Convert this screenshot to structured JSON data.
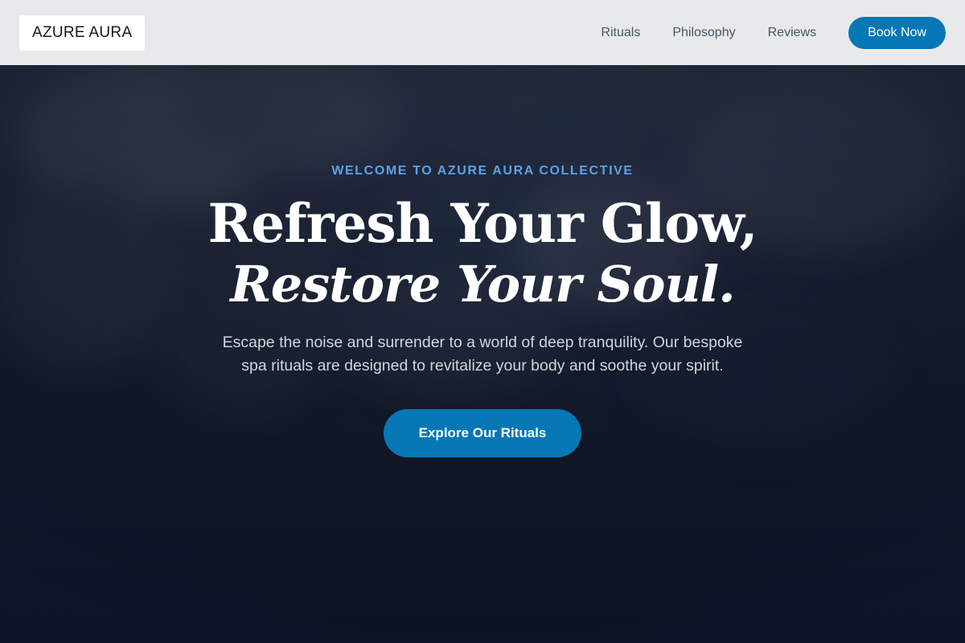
{
  "header": {
    "logo_text": "AZURE AURA",
    "nav": [
      {
        "label": "Rituals"
      },
      {
        "label": "Philosophy"
      },
      {
        "label": "Reviews"
      }
    ],
    "book_button": "Book Now"
  },
  "hero": {
    "eyebrow": "WELCOME TO AZURE AURA COLLECTIVE",
    "headline_line1": "Refresh Your Glow,",
    "headline_line2": "Restore Your Soul.",
    "description": "Escape the noise and surrender to a world of deep tranquility. Our bespoke spa rituals are designed to revitalize your body and soothe your spirit.",
    "cta_button": "Explore Our Rituals"
  },
  "colors": {
    "accent": "#0577b5",
    "eyebrow": "#5aa2e8",
    "header_bg": "#e8e9eb",
    "hero_bg": "#0f172a"
  }
}
